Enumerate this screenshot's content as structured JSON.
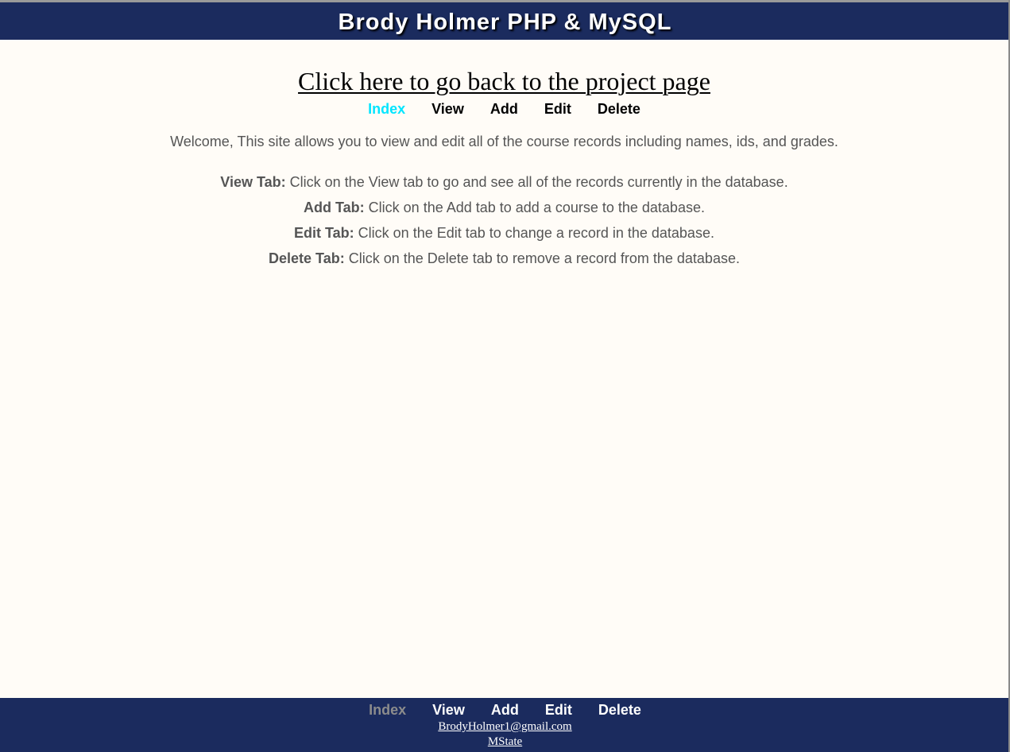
{
  "header": {
    "title": "Brody Holmer PHP & MySQL"
  },
  "main": {
    "back_link": "Click here to go back to the project page",
    "nav": [
      {
        "label": "Index",
        "active": true
      },
      {
        "label": "View",
        "active": false
      },
      {
        "label": "Add",
        "active": false
      },
      {
        "label": "Edit",
        "active": false
      },
      {
        "label": "Delete",
        "active": false
      }
    ],
    "welcome": "Welcome, This site allows you to view and edit all of the course records including names, ids, and grades.",
    "tabs_help": [
      {
        "name": "View Tab:",
        "text": " Click on the View tab to go and see all of the records currently in the database."
      },
      {
        "name": "Add Tab:",
        "text": " Click on the Add tab to add a course to the database."
      },
      {
        "name": "Edit Tab:",
        "text": " Click on the Edit tab to change a record in the database."
      },
      {
        "name": "Delete Tab:",
        "text": " Click on the Delete tab to remove a record from the database."
      }
    ]
  },
  "footer": {
    "nav": [
      {
        "label": "Index",
        "active": true
      },
      {
        "label": "View",
        "active": false
      },
      {
        "label": "Add",
        "active": false
      },
      {
        "label": "Edit",
        "active": false
      },
      {
        "label": "Delete",
        "active": false
      }
    ],
    "email": "BrodyHolmer1@gmail.com",
    "school": "MState"
  },
  "colors": {
    "header_bg": "#1b2b5e",
    "page_bg": "#fffcf7",
    "nav_active": "#00e5ff",
    "footer_active": "#8c8c8c",
    "body_text": "#555555"
  }
}
